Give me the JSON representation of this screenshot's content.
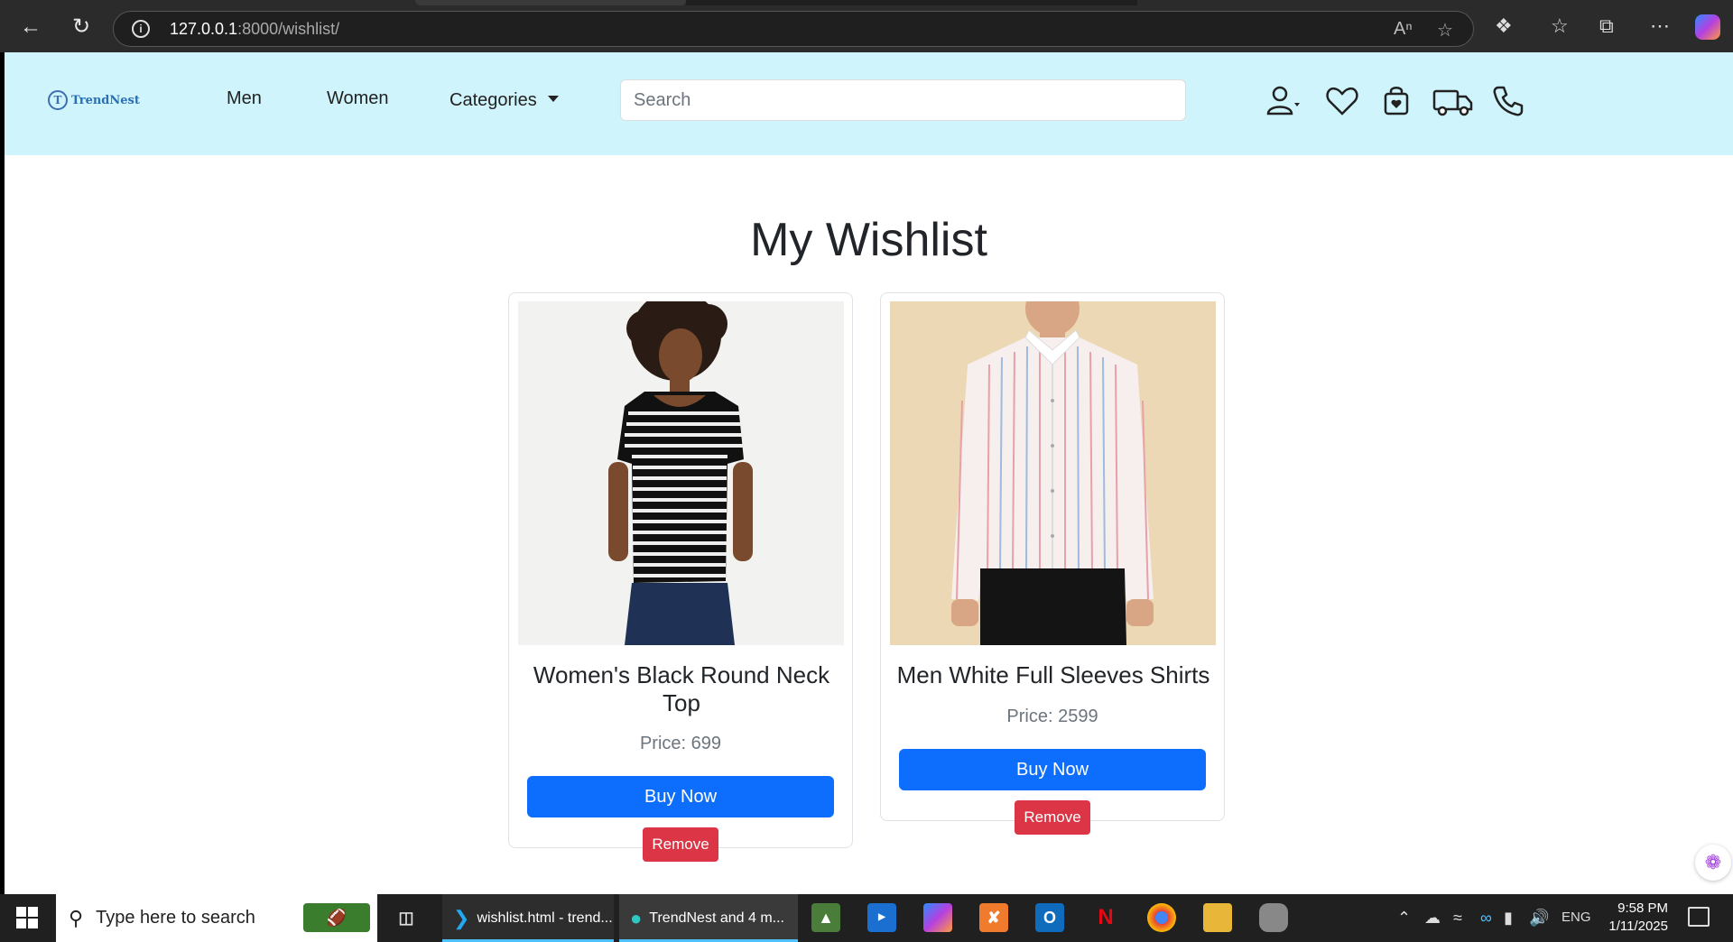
{
  "browser": {
    "url_host": "127.0.0.1",
    "url_path": ":8000/wishlist/"
  },
  "navbar": {
    "logo_mark": "T",
    "logo_text": "TrendNest",
    "links": [
      "Men",
      "Women",
      "Categories"
    ],
    "search_placeholder": "Search"
  },
  "main": {
    "title": "My Wishlist",
    "items": [
      {
        "name": "Women's Black Round Neck Top",
        "price": "Price: 699",
        "buy_label": "Buy Now",
        "remove_label": "Remove"
      },
      {
        "name": "Men White Full Sleeves Shirts",
        "price": "Price: 2599",
        "buy_label": "Buy Now",
        "remove_label": "Remove"
      }
    ]
  },
  "taskbar": {
    "search_placeholder": "Type here to search",
    "apps": [
      {
        "label": "wishlist.html - trend..."
      },
      {
        "label": "TrendNest and 4 m..."
      }
    ],
    "language": "ENG",
    "time": "9:58 PM",
    "date": "1/11/2025"
  },
  "colors": {
    "navbar_bg": "#cff4fc",
    "primary": "#0d6efd",
    "danger": "#dc3545"
  }
}
